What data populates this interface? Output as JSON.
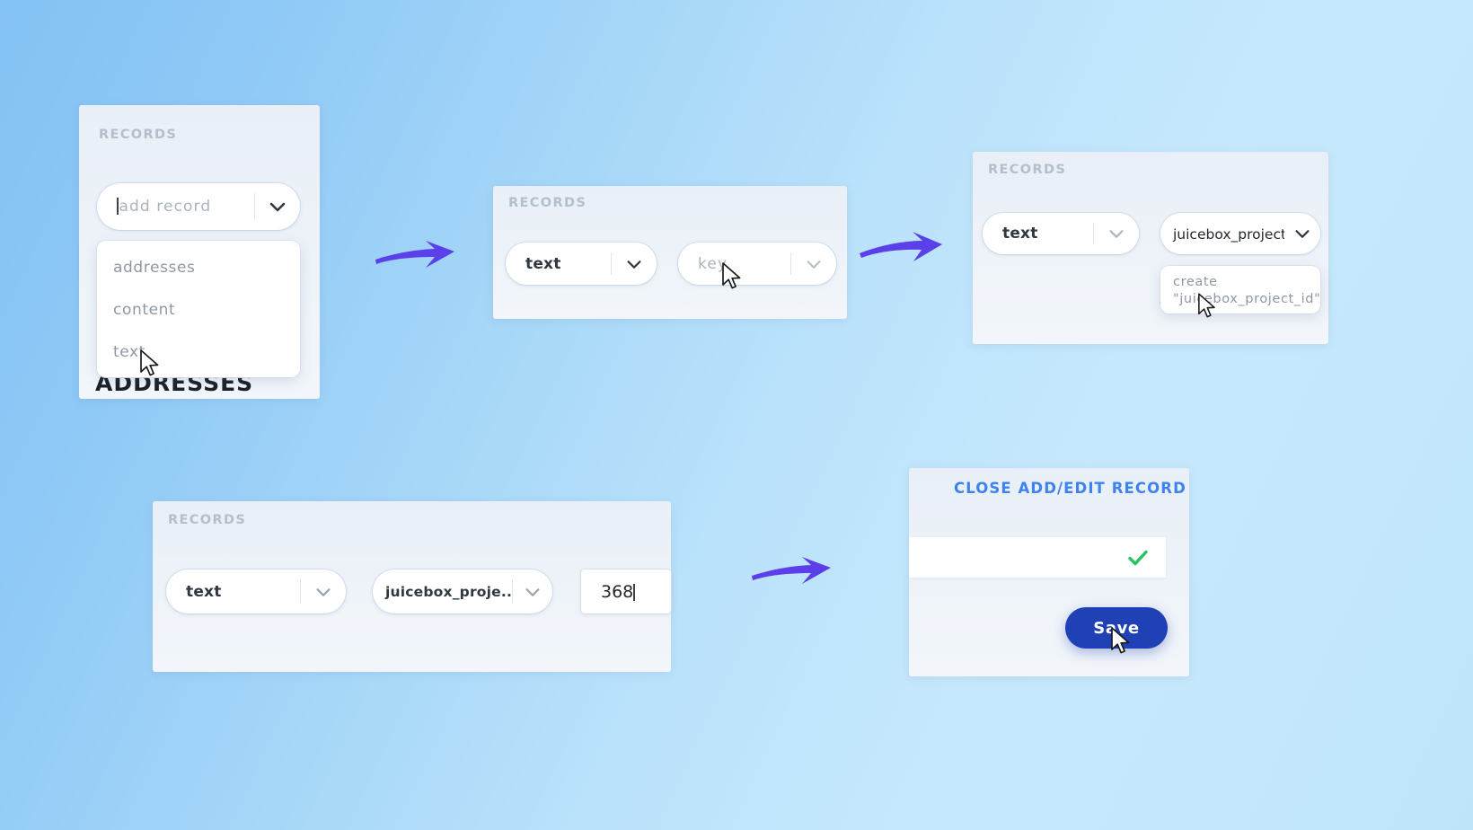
{
  "background": {
    "gradient_from": "#83c2f5",
    "gradient_to": "#c2e4fa"
  },
  "accent": {
    "arrow_color": "#5b3fe8",
    "link_blue": "#3d82ef",
    "save_blue": "#1f41b5",
    "check_green": "#22c55e",
    "title_grey": "#b4bfcc"
  },
  "steps": [
    {
      "id": "step-1-open-add-record",
      "panel_title": "RECORDS",
      "select": {
        "value": "add record",
        "is_placeholder": true,
        "caret_icon": "chevron-down-icon"
      },
      "dropdown_options": [
        "addresses",
        "content",
        "text"
      ],
      "hovered_option": "text",
      "background_label": "ADDRESSES"
    },
    {
      "id": "step-2-choose-key",
      "panel_title": "RECORDS",
      "fields": [
        {
          "name": "type-select",
          "value": "text",
          "is_placeholder": false,
          "caret_icon": "chevron-down-icon"
        },
        {
          "name": "key-select",
          "value": "key",
          "is_placeholder": true,
          "caret_icon": "chevron-down-icon"
        }
      ]
    },
    {
      "id": "step-3-create-key",
      "panel_title": "RECORDS",
      "fields": [
        {
          "name": "type-select",
          "value": "text",
          "is_placeholder": false,
          "caret_icon": "chevron-down-icon"
        },
        {
          "name": "key-combobox",
          "value": "juicebox_project_id",
          "is_placeholder": false,
          "caret_icon": "chevron-down-icon",
          "has_text_cursor": true
        }
      ],
      "dropdown_options": [
        "create\n\"juicebox_project_id\""
      ]
    },
    {
      "id": "step-4-enter-value",
      "panel_title": "RECORDS",
      "fields": [
        {
          "name": "type-select",
          "value": "text",
          "is_placeholder": false,
          "caret_icon": "chevron-down-icon"
        },
        {
          "name": "key-select",
          "value": "juicebox_proje...",
          "is_placeholder": false,
          "caret_icon": "chevron-down-icon"
        },
        {
          "name": "value-input",
          "value": "368",
          "is_placeholder": false,
          "has_text_cursor": true
        }
      ]
    },
    {
      "id": "step-5-save",
      "close_link": "CLOSE ADD/EDIT RECORD",
      "confirm_icon": "check-icon",
      "save_label": "Save"
    }
  ]
}
